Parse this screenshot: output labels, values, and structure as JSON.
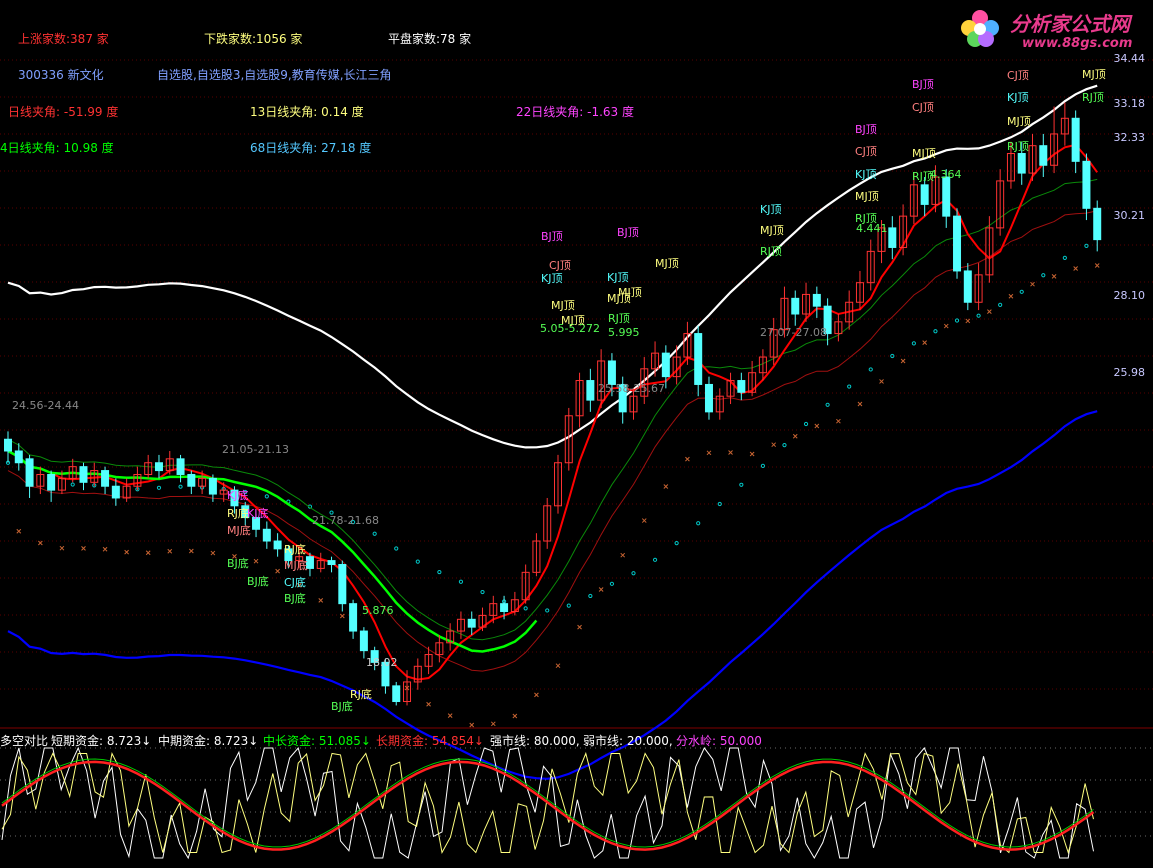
{
  "header": {
    "up_label": "上涨家数:387 家",
    "down_label": "下跌家数:1056 家",
    "flat_label": "平盘家数:78 家",
    "stock_label": "300336 新文化",
    "sectors": "自选股,自选股3,自选股9,教育传媒,长江三角",
    "angle_1": "日线夹角: -51.99 度",
    "angle_13": "13日线夹角: 0.14 度",
    "angle_22": "22日线夹角: -1.63 度",
    "angle_34": "4日线夹角: 10.98 度",
    "angle_68": "68日线夹角: 27.18 度"
  },
  "logo": {
    "name": "分析家公式网",
    "url": "www.88gs.com"
  },
  "colors": {
    "up": "#ff3232",
    "down": "#54ffff",
    "white": "#ffffff",
    "red": "#ff0000",
    "green": "#00ff00",
    "blue": "#0000ff",
    "cyan_dots": "#00c8c8",
    "orange_x": "#c86432",
    "magenta": "#ff44ff",
    "yellow": "#ffff00"
  },
  "price_scale": [
    "34.44",
    "33.18",
    "32.33",
    "30.21",
    "28.10",
    "25.98"
  ],
  "annotations": [
    "24.56-24.44",
    "21.05-21.13",
    "21.78-21.68",
    "18.02",
    "25.58-25.67",
    "27.07-27.08",
    "4.364",
    "4.441",
    "5.876",
    "5.05-5.272",
    "5.995"
  ],
  "signals": {
    "tops": [
      "BJ顶",
      "CJ顶",
      "KJ顶",
      "MJ顶",
      "RJ顶"
    ],
    "bottoms": [
      "KJ底",
      "RJ底",
      "MJ底",
      "BJ底",
      "CJ底"
    ]
  },
  "indicator": {
    "title": "多空对比",
    "items": [
      {
        "label": "短期资金: 8.723↓",
        "color": "#ffffff"
      },
      {
        "label": "中期资金: 8.723↓",
        "color": "#ffffff"
      },
      {
        "label": "中长资金: 51.085↓",
        "color": "#00ff00"
      },
      {
        "label": "长期资金: 54.854↓",
        "color": "#ff3232"
      },
      {
        "label": "强市线: 80.000,",
        "color": "#ffffff"
      },
      {
        "label": "弱市线: 20.000,",
        "color": "#ffffff"
      },
      {
        "label": "分水岭: 50.000",
        "color": "#ff44ff"
      }
    ]
  },
  "chart_data": {
    "type": "candlestick",
    "ylim": [
      17.5,
      35.0
    ],
    "candles": [
      [
        24.8,
        24.5,
        25.0,
        24.2
      ],
      [
        24.5,
        24.2,
        24.7,
        24.0
      ],
      [
        24.3,
        23.6,
        24.4,
        23.3
      ],
      [
        23.6,
        23.9,
        24.1,
        23.4
      ],
      [
        23.9,
        23.5,
        24.0,
        23.2
      ],
      [
        23.5,
        23.8,
        24.0,
        23.4
      ],
      [
        23.8,
        24.1,
        24.3,
        23.7
      ],
      [
        24.1,
        23.7,
        24.2,
        23.5
      ],
      [
        23.7,
        24.0,
        24.2,
        23.6
      ],
      [
        24.0,
        23.6,
        24.1,
        23.4
      ],
      [
        23.6,
        23.3,
        23.8,
        23.1
      ],
      [
        23.3,
        23.6,
        23.8,
        23.2
      ],
      [
        23.6,
        23.9,
        24.1,
        23.5
      ],
      [
        23.9,
        24.2,
        24.4,
        23.8
      ],
      [
        24.2,
        24.0,
        24.4,
        23.8
      ],
      [
        24.0,
        24.3,
        24.5,
        23.9
      ],
      [
        24.3,
        23.9,
        24.4,
        23.7
      ],
      [
        23.9,
        23.6,
        24.0,
        23.4
      ],
      [
        23.6,
        23.8,
        24.0,
        23.4
      ],
      [
        23.8,
        23.4,
        23.9,
        23.2
      ],
      [
        23.4,
        23.5,
        23.7,
        23.2
      ],
      [
        23.5,
        23.1,
        23.6,
        22.9
      ],
      [
        23.1,
        22.8,
        23.2,
        22.6
      ],
      [
        22.8,
        22.5,
        22.9,
        22.3
      ],
      [
        22.5,
        22.2,
        22.7,
        22.0
      ],
      [
        22.2,
        22.0,
        22.4,
        21.8
      ],
      [
        22.0,
        21.7,
        22.1,
        21.5
      ],
      [
        21.7,
        21.8,
        22.0,
        21.5
      ],
      [
        21.8,
        21.5,
        21.9,
        21.3
      ],
      [
        21.5,
        21.7,
        21.9,
        21.4
      ],
      [
        21.7,
        21.6,
        21.8,
        21.4
      ],
      [
        21.6,
        20.6,
        21.7,
        20.4
      ],
      [
        20.6,
        19.9,
        20.7,
        19.7
      ],
      [
        19.9,
        19.4,
        20.0,
        19.2
      ],
      [
        19.4,
        19.1,
        19.5,
        18.9
      ],
      [
        19.1,
        18.5,
        19.2,
        18.3
      ],
      [
        18.5,
        18.1,
        18.6,
        18.0
      ],
      [
        18.1,
        18.6,
        18.9,
        18.0
      ],
      [
        18.6,
        19.0,
        19.2,
        18.4
      ],
      [
        19.0,
        19.3,
        19.5,
        18.8
      ],
      [
        19.3,
        19.6,
        19.8,
        19.1
      ],
      [
        19.6,
        19.9,
        20.1,
        19.4
      ],
      [
        19.9,
        20.2,
        20.4,
        19.7
      ],
      [
        20.2,
        20.0,
        20.4,
        19.8
      ],
      [
        20.0,
        20.3,
        20.5,
        19.9
      ],
      [
        20.3,
        20.6,
        20.8,
        20.1
      ],
      [
        20.6,
        20.4,
        20.8,
        20.2
      ],
      [
        20.4,
        20.7,
        20.9,
        20.3
      ],
      [
        20.7,
        21.4,
        21.6,
        20.6
      ],
      [
        21.4,
        22.2,
        22.4,
        21.3
      ],
      [
        22.2,
        23.1,
        23.3,
        22.0
      ],
      [
        23.1,
        24.2,
        24.4,
        22.9
      ],
      [
        24.2,
        25.4,
        25.6,
        24.0
      ],
      [
        25.4,
        26.3,
        26.5,
        25.1
      ],
      [
        26.3,
        25.8,
        26.6,
        25.5
      ],
      [
        25.8,
        26.8,
        27.1,
        25.6
      ],
      [
        26.8,
        26.2,
        27.0,
        25.9
      ],
      [
        26.2,
        25.5,
        26.4,
        25.2
      ],
      [
        25.5,
        25.9,
        26.1,
        25.3
      ],
      [
        25.9,
        26.6,
        26.9,
        25.7
      ],
      [
        26.6,
        27.0,
        27.3,
        26.4
      ],
      [
        27.0,
        26.4,
        27.2,
        26.1
      ],
      [
        26.4,
        26.9,
        27.2,
        26.2
      ],
      [
        26.9,
        27.5,
        27.8,
        26.7
      ],
      [
        27.5,
        26.2,
        27.7,
        25.9
      ],
      [
        26.2,
        25.5,
        26.4,
        25.3
      ],
      [
        25.5,
        25.9,
        26.1,
        25.3
      ],
      [
        25.9,
        26.3,
        26.5,
        25.7
      ],
      [
        26.3,
        26.0,
        26.5,
        25.8
      ],
      [
        26.0,
        26.5,
        26.8,
        25.9
      ],
      [
        26.5,
        26.9,
        27.1,
        26.3
      ],
      [
        26.9,
        27.6,
        27.9,
        26.7
      ],
      [
        27.6,
        28.4,
        28.7,
        27.4
      ],
      [
        28.4,
        28.0,
        28.6,
        27.7
      ],
      [
        28.0,
        28.5,
        28.8,
        27.8
      ],
      [
        28.5,
        28.2,
        28.7,
        27.9
      ],
      [
        28.2,
        27.5,
        28.4,
        27.2
      ],
      [
        27.5,
        27.8,
        28.0,
        27.3
      ],
      [
        27.8,
        28.3,
        28.6,
        27.6
      ],
      [
        28.3,
        28.8,
        29.1,
        28.1
      ],
      [
        28.8,
        29.6,
        29.9,
        28.6
      ],
      [
        29.6,
        30.2,
        30.4,
        29.3
      ],
      [
        30.2,
        29.7,
        30.5,
        29.4
      ],
      [
        29.7,
        30.5,
        30.8,
        29.5
      ],
      [
        30.5,
        31.3,
        31.6,
        30.3
      ],
      [
        31.3,
        30.8,
        31.5,
        30.5
      ],
      [
        30.8,
        31.5,
        31.8,
        30.6
      ],
      [
        31.5,
        30.5,
        31.7,
        30.2
      ],
      [
        30.5,
        29.1,
        30.7,
        28.9
      ],
      [
        29.1,
        28.3,
        29.3,
        28.1
      ],
      [
        28.3,
        29.0,
        29.3,
        28.1
      ],
      [
        29.0,
        30.2,
        30.5,
        28.8
      ],
      [
        30.2,
        31.4,
        31.7,
        30.0
      ],
      [
        31.4,
        32.1,
        32.4,
        31.2
      ],
      [
        32.1,
        31.6,
        32.4,
        31.3
      ],
      [
        31.6,
        32.3,
        32.6,
        31.4
      ],
      [
        32.3,
        31.8,
        32.6,
        31.5
      ],
      [
        31.8,
        32.6,
        33.3,
        31.6
      ],
      [
        32.6,
        33.0,
        33.4,
        32.3
      ],
      [
        33.0,
        31.9,
        33.2,
        31.6
      ],
      [
        31.9,
        30.7,
        32.1,
        30.4
      ],
      [
        30.7,
        29.9,
        30.9,
        29.6
      ]
    ],
    "series": [
      {
        "name": "upper_band"
      },
      {
        "name": "lower_band"
      },
      {
        "name": "mid_red"
      },
      {
        "name": "green_ma"
      }
    ]
  }
}
